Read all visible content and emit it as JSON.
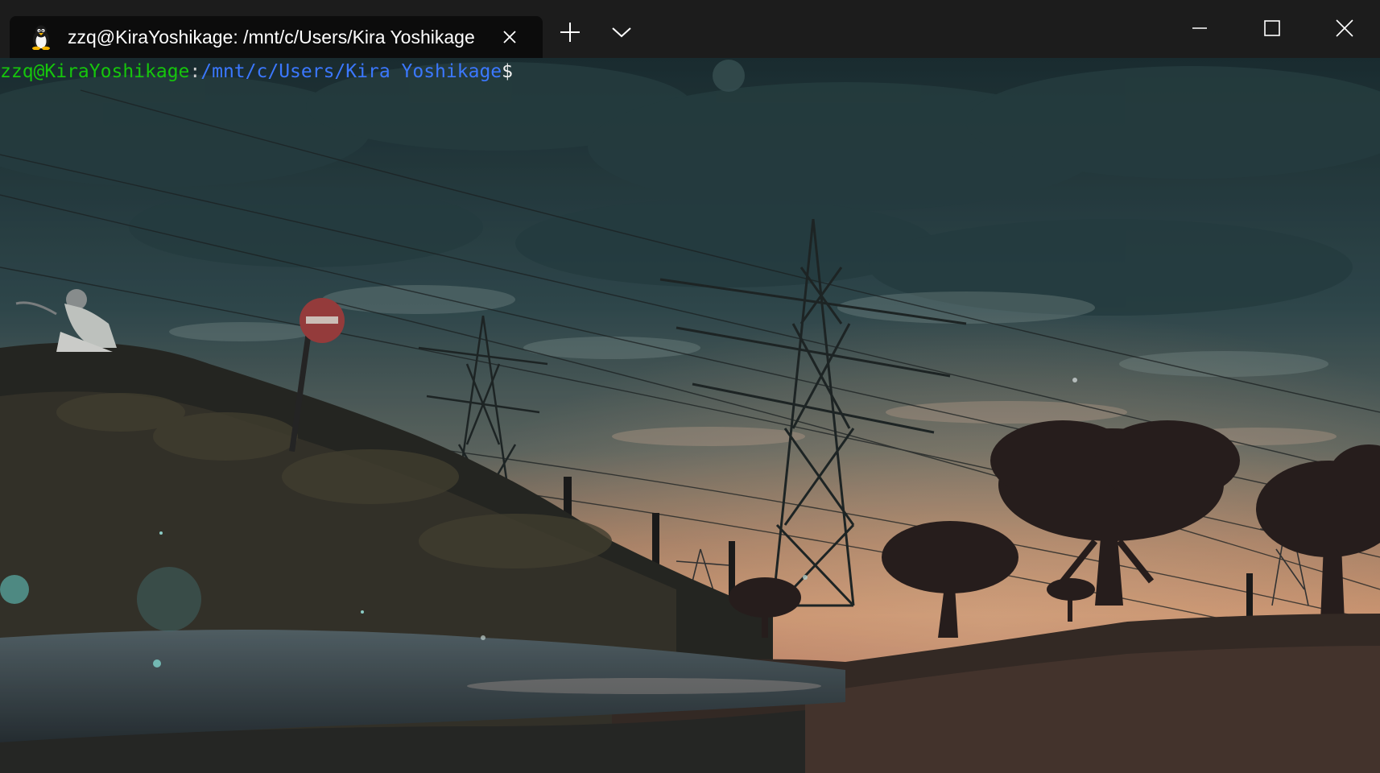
{
  "window": {
    "tab": {
      "title": "zzq@KiraYoshikage: /mnt/c/Users/Kira Yoshikage",
      "icon": "linux-penguin-icon"
    },
    "controls": {
      "new_tab_icon": "plus-icon",
      "dropdown_icon": "chevron-down-icon",
      "minimize_icon": "minimize-icon",
      "maximize_icon": "maximize-icon",
      "close_icon": "close-icon"
    }
  },
  "terminal": {
    "prompt": {
      "user_host": "zzq@KiraYoshikage",
      "separator": ":",
      "path": "/mnt/c/Users/Kira Yoshikage",
      "symbol": "$"
    },
    "colors": {
      "user_host": "#16c60c",
      "path": "#3b78ff",
      "text": "#f2f2f2",
      "titlebar": "#1c1c1c",
      "tab": "#0c0c0c"
    }
  }
}
